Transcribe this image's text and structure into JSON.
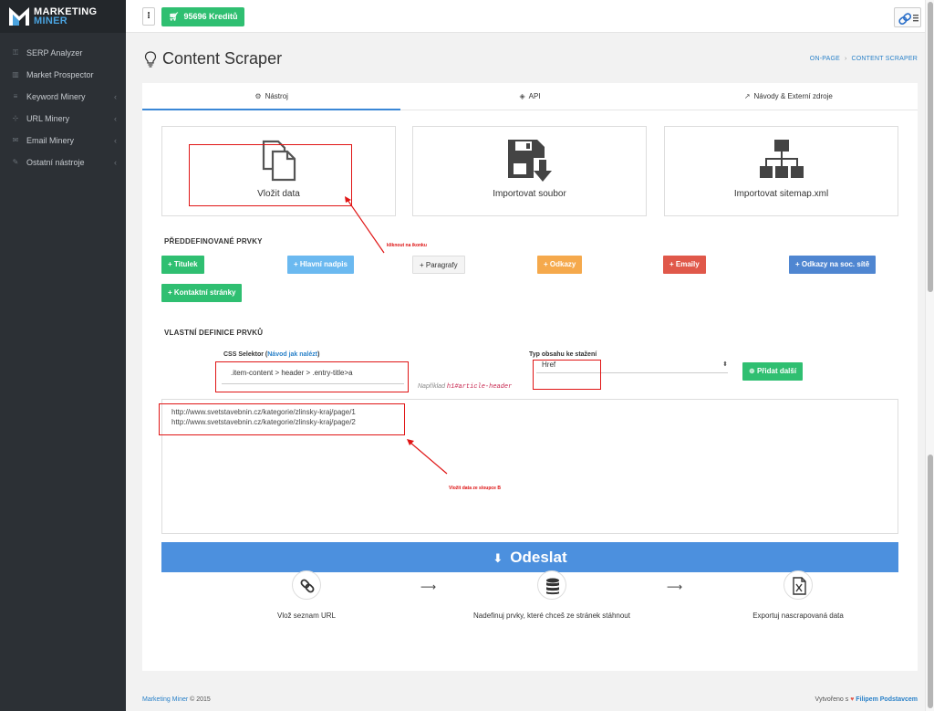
{
  "sidebar": {
    "logo_line1": "MARKETING",
    "logo_line2": "MINER",
    "items": [
      {
        "label": "SERP Analyzer",
        "has_chevron": false
      },
      {
        "label": "Market Prospector",
        "has_chevron": false
      },
      {
        "label": "Keyword Minery",
        "has_chevron": true
      },
      {
        "label": "URL Minery",
        "has_chevron": true
      },
      {
        "label": "Email Minery",
        "has_chevron": true
      },
      {
        "label": "Ostatní nástroje",
        "has_chevron": true
      }
    ]
  },
  "topbar": {
    "menu_glyph": "⁝",
    "credits_label": "95696 Kreditů"
  },
  "page": {
    "title": "Content Scraper",
    "breadcrumb": [
      "ON-PAGE",
      "CONTENT SCRAPER"
    ]
  },
  "tabs": [
    {
      "label": "Nástroj",
      "icon": "gears-icon",
      "active": true
    },
    {
      "label": "API",
      "icon": "cube-icon",
      "active": false
    },
    {
      "label": "Návody & Externí zdroje",
      "icon": "external-link-icon",
      "active": false
    }
  ],
  "cards": [
    {
      "label": "Vložit data",
      "icon": "paste-icon"
    },
    {
      "label": "Importovat soubor",
      "icon": "save-import-icon"
    },
    {
      "label": "Importovat sitemap.xml",
      "icon": "sitemap-icon"
    }
  ],
  "predefined": {
    "title": "PŘEDDEFINOVANÉ PRVKY",
    "buttons": [
      {
        "label": "+ Titulek",
        "color": "#2fbf71"
      },
      {
        "label": "+ Hlavní nadpis",
        "color": "#6bb9f0"
      },
      {
        "label": "+ Paragrafy",
        "color": "#f4f4f4"
      },
      {
        "label": "+ Odkazy",
        "color": "#f5a94c"
      },
      {
        "label": "+ Emaily",
        "color": "#e0584a"
      },
      {
        "label": "+ Odkazy na soc. sítě",
        "color": "#4f86d1"
      },
      {
        "label": "+ Kontaktní stránky",
        "color": "#2fbf71"
      }
    ]
  },
  "custom": {
    "title": "VLASTNÍ DEFINICE PRVKŮ",
    "css_label": "CSS Selektor",
    "css_help_link": "Návod jak nalézt",
    "css_value": ".item-content > header > .entry-title>a",
    "hint_prefix": "Například",
    "hint_code": "h1#article-header",
    "type_label": "Typ obsahu ke stažení",
    "type_value": "Href",
    "add_label": "Přidat další"
  },
  "urls_text": "http://www.svetstavebnin.cz/kategorie/zlinsky-kraj/page/1\nhttp://www.svetstavebnin.cz/kategorie/zlinsky-kraj/page/2",
  "submit_label": "Odeslat",
  "steps": [
    {
      "label": "Vlož seznam URL",
      "icon": "link-icon"
    },
    {
      "label": "Nadefinuj prvky, které chceš ze stránek stáhnout",
      "icon": "database-icon"
    },
    {
      "label": "Exportuj nascrapovaná data",
      "icon": "excel-file-icon"
    }
  ],
  "annotations": {
    "click_icon": "kliknout na ikonku",
    "paste_column": "Vložit data ze sloupce B",
    "color": "#e01515"
  },
  "footer": {
    "brand": "Marketing Miner",
    "copyright": "© 2015",
    "created_prefix": "Vytvořeno s",
    "author": "Filipem Podstavcem"
  }
}
